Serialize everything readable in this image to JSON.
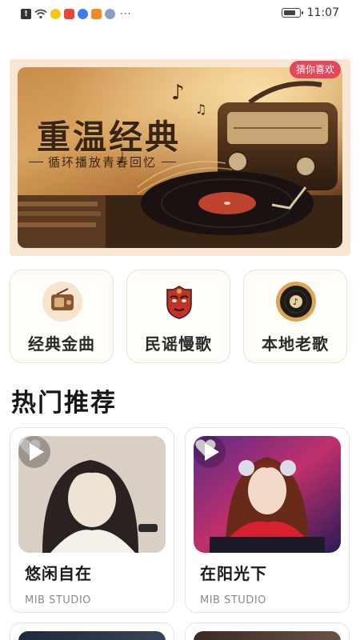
{
  "status_bar": {
    "time": "11:07",
    "left_icons": [
      "alert-icon",
      "wifi-icon",
      "weibo-icon",
      "app-red-icon",
      "music-icon",
      "app-orange-icon",
      "avatar-icon"
    ],
    "more": "···"
  },
  "banner": {
    "title": "重温经典",
    "subtitle": "循环播放青春回忆",
    "badge": "猜你喜欢"
  },
  "categories": [
    {
      "label": "经典金曲",
      "icon": "radio-icon"
    },
    {
      "label": "民谣慢歌",
      "icon": "opera-mask-icon"
    },
    {
      "label": "本地老歌",
      "icon": "vinyl-record-icon"
    }
  ],
  "section": {
    "title": "热门推荐"
  },
  "cards": [
    {
      "title": "悠闲自在",
      "subtitle": "MIB STUDIO"
    },
    {
      "title": "在阳光下",
      "subtitle": "MIB STUDIO"
    }
  ],
  "colors": {
    "badge": "#e3475a",
    "card_border": "#f0e0c8",
    "banner_bg": "#f6e6d2"
  }
}
